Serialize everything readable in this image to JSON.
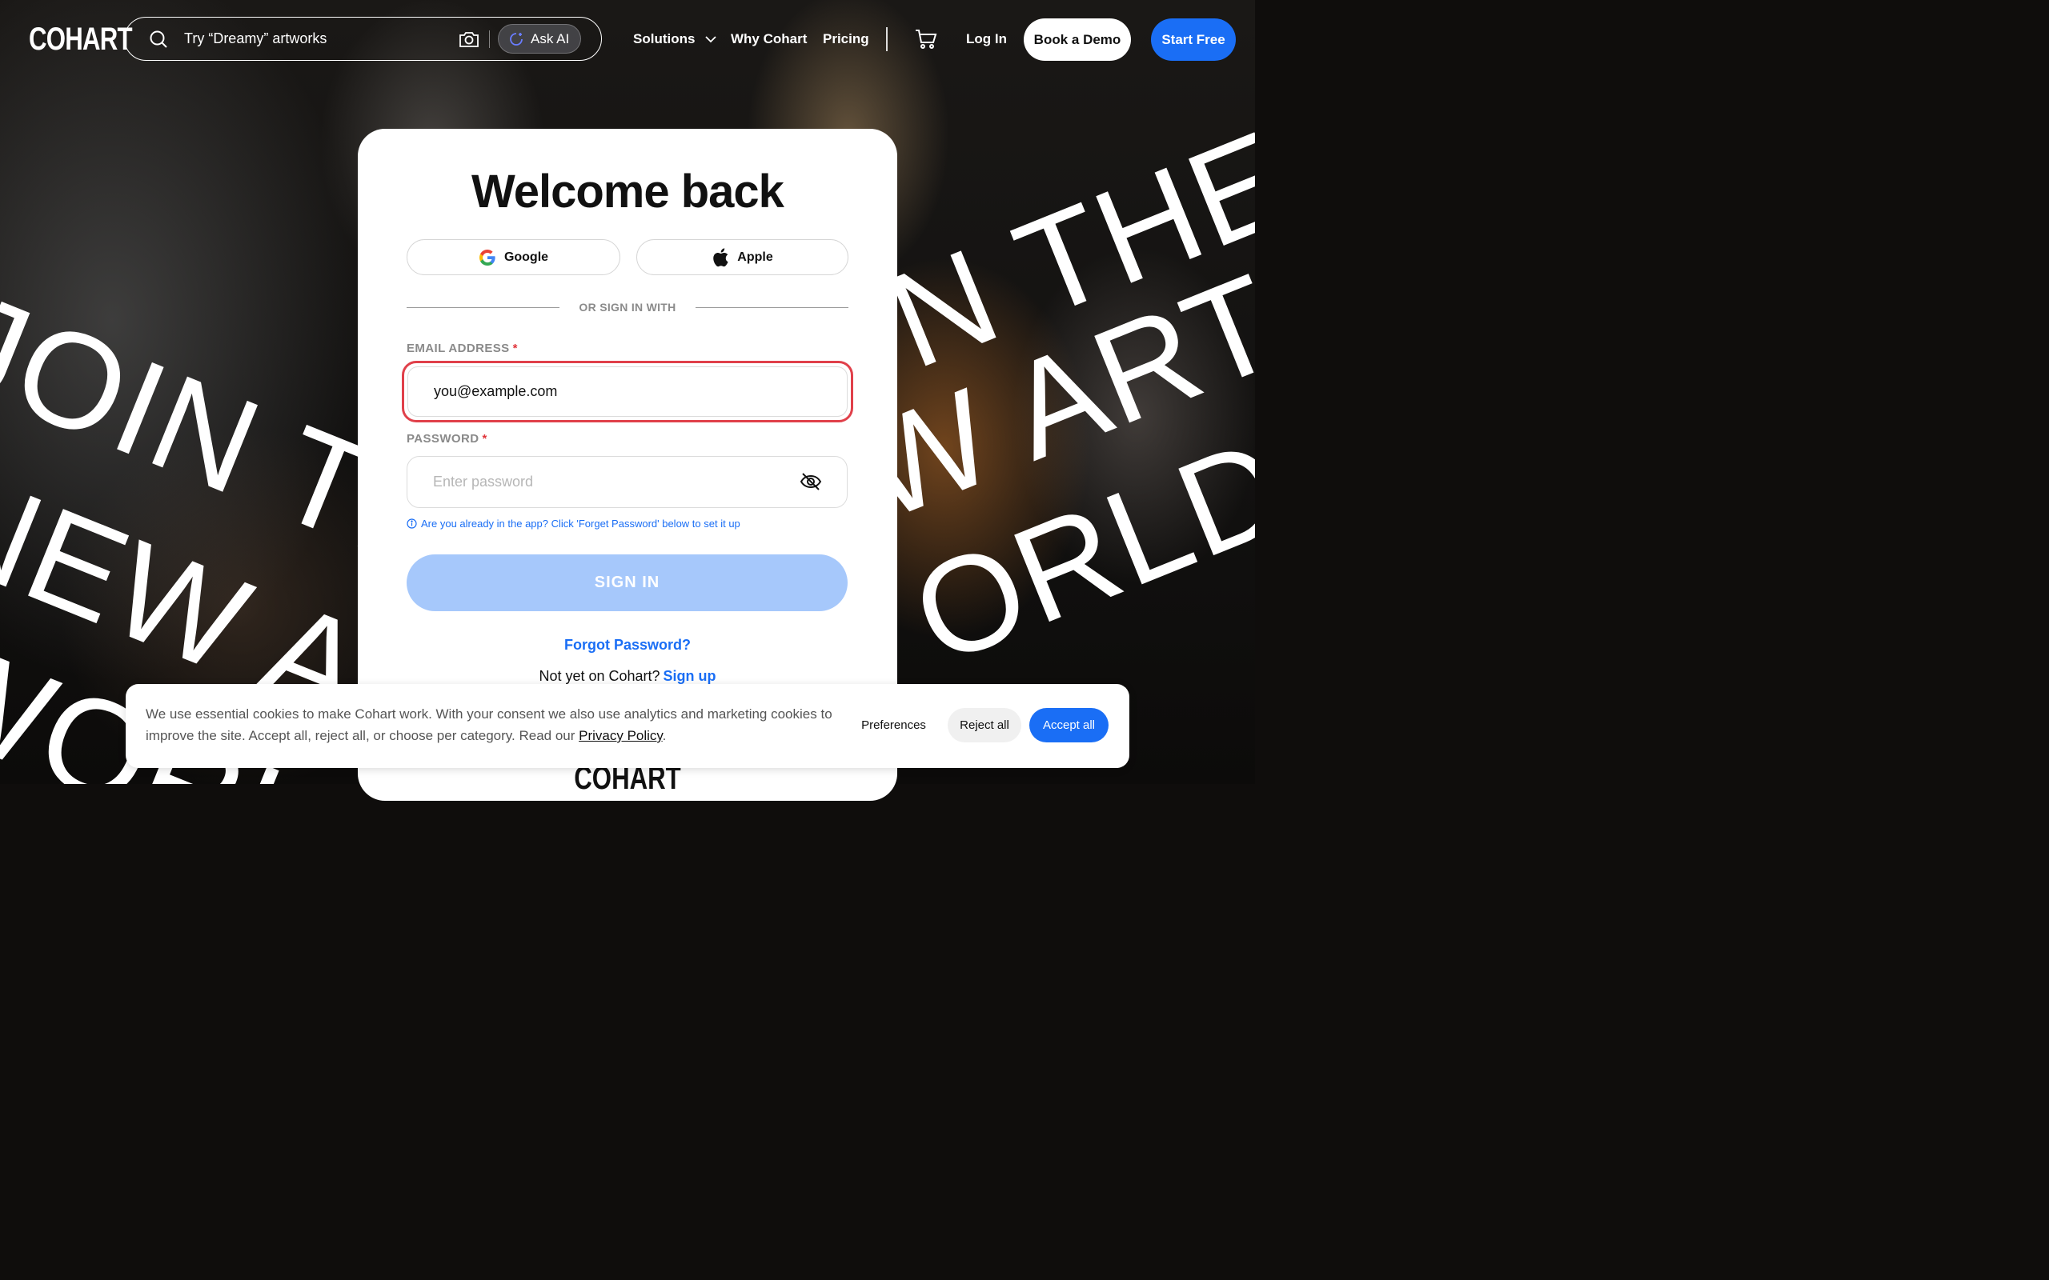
{
  "background": {
    "headline_left": [
      "JOIN TH",
      "NEW AR",
      "WORL"
    ],
    "headline_right": [
      "N THE",
      "W ART",
      "ORLD"
    ]
  },
  "header": {
    "logo": "COHART",
    "search_placeholder": "Try “Dreamy” artworks",
    "ask_ai": "Ask AI",
    "nav": {
      "solutions": "Solutions",
      "why": "Why Cohart",
      "pricing": "Pricing",
      "login": "Log In"
    },
    "book_demo": "Book a Demo",
    "start_free": "Start Free"
  },
  "login": {
    "title": "Welcome back",
    "google_label": "Google",
    "apple_label": "Apple",
    "divider_text": "OR SIGN IN WITH",
    "email_label": "EMAIL ADDRESS",
    "email_value": "you@example.com",
    "password_label": "PASSWORD",
    "password_placeholder": "Enter password",
    "required_mark": "*",
    "hint": "Are you already in the app? Click 'Forget Password' below to set it up",
    "signin_label": "SIGN IN",
    "forgot": "Forgot Password?",
    "not_yet": "Not yet on Cohart?",
    "signup": "Sign up",
    "footer_logo": "COHART"
  },
  "cookie": {
    "text": "We use essential cookies to make Cohart work. With your consent we also use analytics and marketing cookies to improve the site. Accept all, reject all, or choose per category. Read our ",
    "policy": "Privacy Policy",
    "period": ".",
    "preferences": "Preferences",
    "reject": "Reject all",
    "accept": "Accept all"
  },
  "colors": {
    "accent": "#1a6ef5",
    "error_border": "#e0404a",
    "disabled_button": "#a6c8fb"
  }
}
